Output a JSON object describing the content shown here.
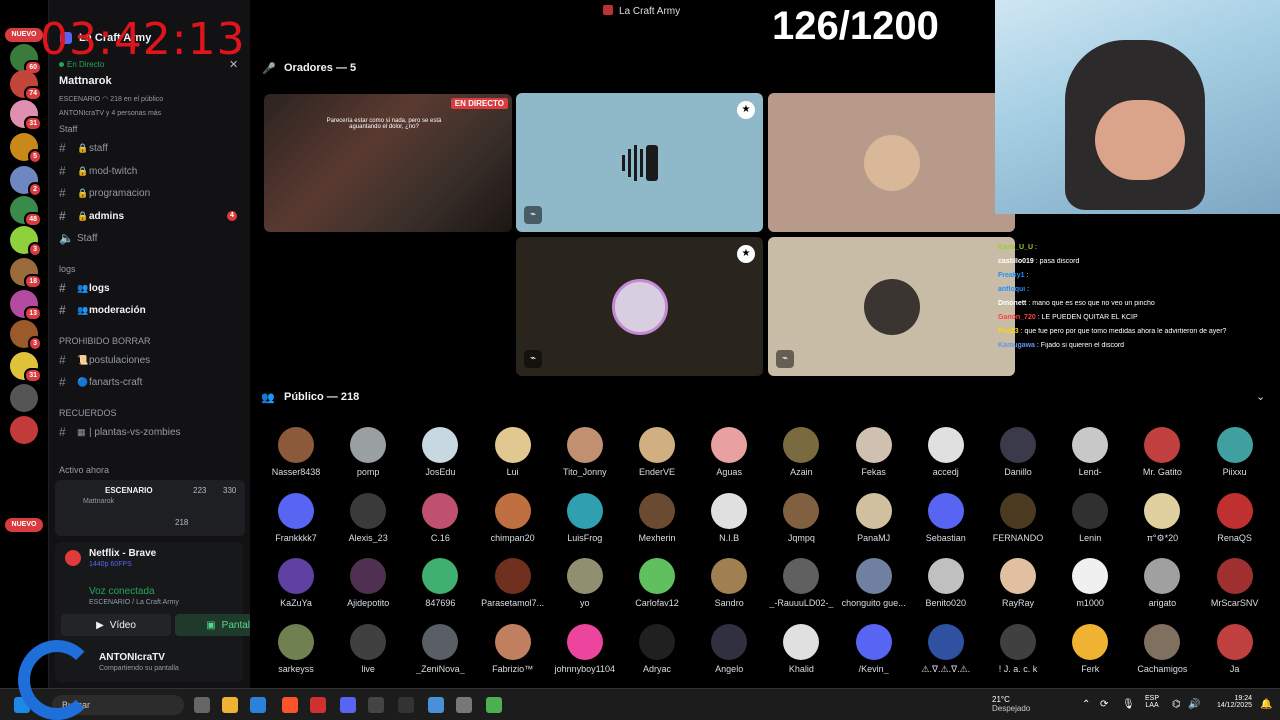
{
  "overlay": {
    "timer": "03:42:13",
    "counter": "126/1200"
  },
  "rail": {
    "new_label": "NUEVO",
    "badges": [
      "60",
      "74",
      "31",
      "5",
      "2",
      "48",
      "3",
      "18",
      "13",
      "3",
      "31"
    ],
    "colors": [
      "#3a7a3a",
      "#c2453a",
      "#e08fb0",
      "#c9891a",
      "#6f87c0",
      "#3a8a4a",
      "#8fd13a",
      "#9a6a3a",
      "#b24aa0",
      "#9a5a2a",
      "#e0c23a",
      "#555555",
      "#c23a3a"
    ]
  },
  "server": {
    "name": "La Craft Army",
    "stage_status": "En Directo",
    "stage_host": "Mattnarok",
    "stage_meta": "ESCENARIO   ◠ 218 en el público",
    "stage_meta2": "ANTONIcraTV y 4 personas más"
  },
  "channels": {
    "cat_staff": "Staff",
    "items": [
      {
        "label": "staff"
      },
      {
        "label": "mod-twitch"
      },
      {
        "label": "programacion"
      },
      {
        "label": "admins",
        "badge": "4"
      },
      {
        "label": "Staff"
      }
    ],
    "cat_logs": "logs",
    "logs": [
      {
        "label": "logs"
      },
      {
        "label": "moderación"
      }
    ],
    "cat_prohibido": "PROHIBIDO BORRAR",
    "prohibido": [
      {
        "label": "postulaciones"
      },
      {
        "label": "fanarts-craft"
      }
    ],
    "cat_recuerdos": "RECUERDOS",
    "recuerdos": [
      {
        "label": "| plantas-vs-zombies"
      }
    ]
  },
  "active_now": {
    "label": "Activo ahora",
    "card_title": "ESCENARIO",
    "card_sub": "Mattnarok",
    "count_video": "223",
    "count_users": "330",
    "count_listeners": "218"
  },
  "panel": {
    "app_title": "Netflix - Brave",
    "app_sub": "1440p 60FPS",
    "voice_title": "Voz conectada",
    "voice_sub": "ESCENARIO / La Craft Army",
    "video_btn": "Vídeo",
    "screen_btn": "Pantalla",
    "user_name": "ANTONIcraTV",
    "user_status": "Compartiendo su pantalla"
  },
  "main": {
    "window_title": "La Craft Army",
    "speakers_label": "Oradores — 5",
    "audience_label": "Público — 218",
    "live_tag": "EN DIRECTO",
    "stream_caption": "Parecería estar como si nada, pero se está aguantando el dolor, ¿no?"
  },
  "chat": [
    {
      "user": "Kami_U_U",
      "msg": ":",
      "color": "#9acd32"
    },
    {
      "user": "castillo019",
      "msg": ": pasa discord",
      "color": "#ffffff"
    },
    {
      "user": "Freaky1",
      "msg": ":",
      "color": "#1e90ff"
    },
    {
      "user": "anfloqui",
      "msg": ":",
      "color": "#1e90ff"
    },
    {
      "user": "Dmonett",
      "msg": ": mano que es eso que no veo un pincho",
      "color": "#ffffff"
    },
    {
      "user": "Ganon_720",
      "msg": ": LE PUEDEN QUITAR EL KCIP",
      "color": "#ff4040"
    },
    {
      "user": "Frix23",
      "msg": ": que fue pero por que tomo medidas ahora le advirtieron de ayer?",
      "color": "#ffd700"
    },
    {
      "user": "Kamugawa",
      "msg": ": Fijado si quieren el discord",
      "color": "#6495ed"
    }
  ],
  "audience": [
    {
      "name": "Nasser8438",
      "color": "#8a5a3a"
    },
    {
      "name": "pomp",
      "color": "#9aa0a0"
    },
    {
      "name": "JosEdu",
      "color": "#c8d8e0"
    },
    {
      "name": "Lui",
      "color": "#e0c890"
    },
    {
      "name": "Tito_Jonny",
      "color": "#c09070"
    },
    {
      "name": "EnderVE",
      "color": "#d0b080"
    },
    {
      "name": "Aguas",
      "color": "#e8a0a0"
    },
    {
      "name": "Azain",
      "color": "#7a6a40"
    },
    {
      "name": "Fekas",
      "color": "#d0c0b0"
    },
    {
      "name": "accedj",
      "color": "#e0e0e0"
    },
    {
      "name": "Danillo",
      "color": "#3a3a4a"
    },
    {
      "name": "Lend-",
      "color": "#c8c8c8"
    },
    {
      "name": "Mr. Gatito",
      "color": "#c04040"
    },
    {
      "name": "Piixxu",
      "color": "#40a0a0"
    },
    {
      "name": "Frankkkk7",
      "color": "#5865f2"
    },
    {
      "name": "Alexis_23",
      "color": "#3a3a3a"
    },
    {
      "name": "C.16",
      "color": "#c05070"
    },
    {
      "name": "chimpan20",
      "color": "#c07040"
    },
    {
      "name": "LuisFrog",
      "color": "#30a0b0"
    },
    {
      "name": "Mexherin",
      "color": "#6a4a30"
    },
    {
      "name": "N.I.B",
      "color": "#e0e0e0"
    },
    {
      "name": "Jqmpq",
      "color": "#806040"
    },
    {
      "name": "PanaMJ",
      "color": "#d0c0a0"
    },
    {
      "name": "Sebastian",
      "color": "#5865f2"
    },
    {
      "name": "FERNANDO",
      "color": "#4a3a20"
    },
    {
      "name": "Lenin",
      "color": "#303030"
    },
    {
      "name": "π°⚙*20",
      "color": "#e0d0a0"
    },
    {
      "name": "RenaQS",
      "color": "#c03030"
    },
    {
      "name": "KaZuYa",
      "color": "#6040a0"
    },
    {
      "name": "Ajidepotito",
      "color": "#503050"
    },
    {
      "name": "847696",
      "color": "#40b070"
    },
    {
      "name": "Parasetamol7...",
      "color": "#703020"
    },
    {
      "name": "yo",
      "color": "#909070"
    },
    {
      "name": "Carlofav12",
      "color": "#60c060"
    },
    {
      "name": "Sandro",
      "color": "#a08050"
    },
    {
      "name": "_-RauuuLD02-_",
      "color": "#606060"
    },
    {
      "name": "chonguito gue...",
      "color": "#7080a0"
    },
    {
      "name": "Benito020",
      "color": "#c0c0c0"
    },
    {
      "name": "RayRay",
      "color": "#e0c0a0"
    },
    {
      "name": "m1000",
      "color": "#f0f0f0"
    },
    {
      "name": "arigato",
      "color": "#a0a0a0"
    },
    {
      "name": "MrScarSNV",
      "color": "#a03030"
    },
    {
      "name": "sarkeyss",
      "color": "#708050"
    },
    {
      "name": "live",
      "color": "#404040"
    },
    {
      "name": "_ZeniNova_",
      "color": "#5a5f66"
    },
    {
      "name": "Fabrizio™",
      "color": "#c08060"
    },
    {
      "name": "johnnyboy1104",
      "color": "#eb459e"
    },
    {
      "name": "Adryac",
      "color": "#202020"
    },
    {
      "name": "Angelo",
      "color": "#303040"
    },
    {
      "name": "Khalid",
      "color": "#e0e0e0"
    },
    {
      "name": "/Kevin_",
      "color": "#5865f2"
    },
    {
      "name": "⚠.∇.⚠.∇.⚠.",
      "color": "#3050a0"
    },
    {
      "name": "! J. a. c. k",
      "color": "#404040"
    },
    {
      "name": "Ferk",
      "color": "#f0b232"
    },
    {
      "name": "Cachamigos",
      "color": "#807060"
    },
    {
      "name": "Ja",
      "color": "#c04040"
    }
  ],
  "taskbar": {
    "search": "Buscar",
    "weather_temp": "21°C",
    "weather_desc": "Despejado",
    "lang1": "ESP",
    "lang2": "LAA",
    "time": "19:24",
    "date": "14/12/2025",
    "weather_badge": "2"
  }
}
